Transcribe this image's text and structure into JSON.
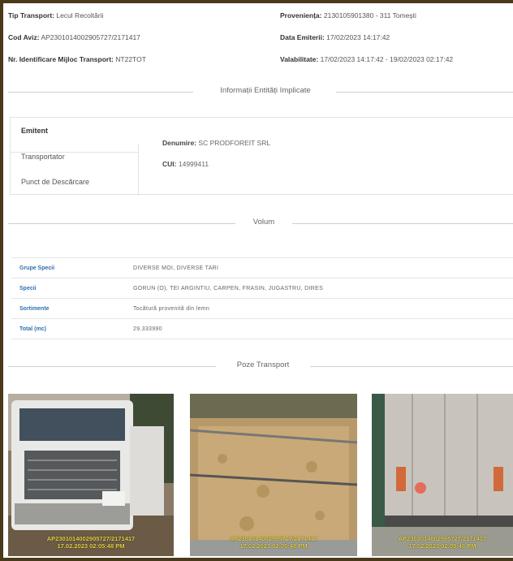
{
  "header": {
    "tip_transport_label": "Tip Transport:",
    "tip_transport_value": "Lecul Recoltării",
    "cod_aviz_label": "Cod Aviz:",
    "cod_aviz_value": "AP2301014002905727/2171417",
    "nr_identificare_label": "Nr. Identificare Mijloc Transport:",
    "nr_identificare_value": "NT22TOT",
    "provenienta_label": "Proveniența:",
    "provenienta_value": "2130105901380 - 311 Tomești",
    "data_emiterii_label": "Data Emiterii:",
    "data_emiterii_value": "17/02/2023 14:17:42",
    "valabilitate_label": "Valabilitate:",
    "valabilitate_value": "17/02/2023 14:17:42 - 19/02/2023 02:17:42"
  },
  "sections": {
    "entitati": "Informații Entități Implicate",
    "volum": "Volum",
    "poze": "Poze Transport"
  },
  "tabs": [
    {
      "label": "Emitent"
    },
    {
      "label": "Transportator"
    },
    {
      "label": "Punct de Descărcare"
    }
  ],
  "emitent": {
    "denumire_label": "Denumire:",
    "denumire_value": "SC PRODFOREIT SRL",
    "cui_label": "CUI:",
    "cui_value": "14999411"
  },
  "volum_table": [
    {
      "key": "Grupe Specii",
      "value": "DIVERSE MOI, DIVERSE TARI"
    },
    {
      "key": "Specii",
      "value": "GORUN (O), TEI ARGINTIU, CARPEN, FRASIN, JUGASTRU, DIRES"
    },
    {
      "key": "Sortimente",
      "value": "Tocătură provenită din lemn"
    },
    {
      "key": "Total (mc)",
      "value": "29.333990"
    }
  ],
  "photos": [
    {
      "stamp": "AP2301014002905727/2171417\n17.02.2023 02:05:48 PM"
    },
    {
      "stamp": "AP2301014002905727/2171417\n17.02.2023 02:05:48 PM"
    },
    {
      "stamp": "AP2301014002905727/2171417\n17.02.2023 02:05:48 PM"
    }
  ],
  "colors": {
    "link_blue": "#2f6fb0",
    "stamp_yellow": "#e6d64a",
    "frame_brown": "#4a3a1a"
  }
}
